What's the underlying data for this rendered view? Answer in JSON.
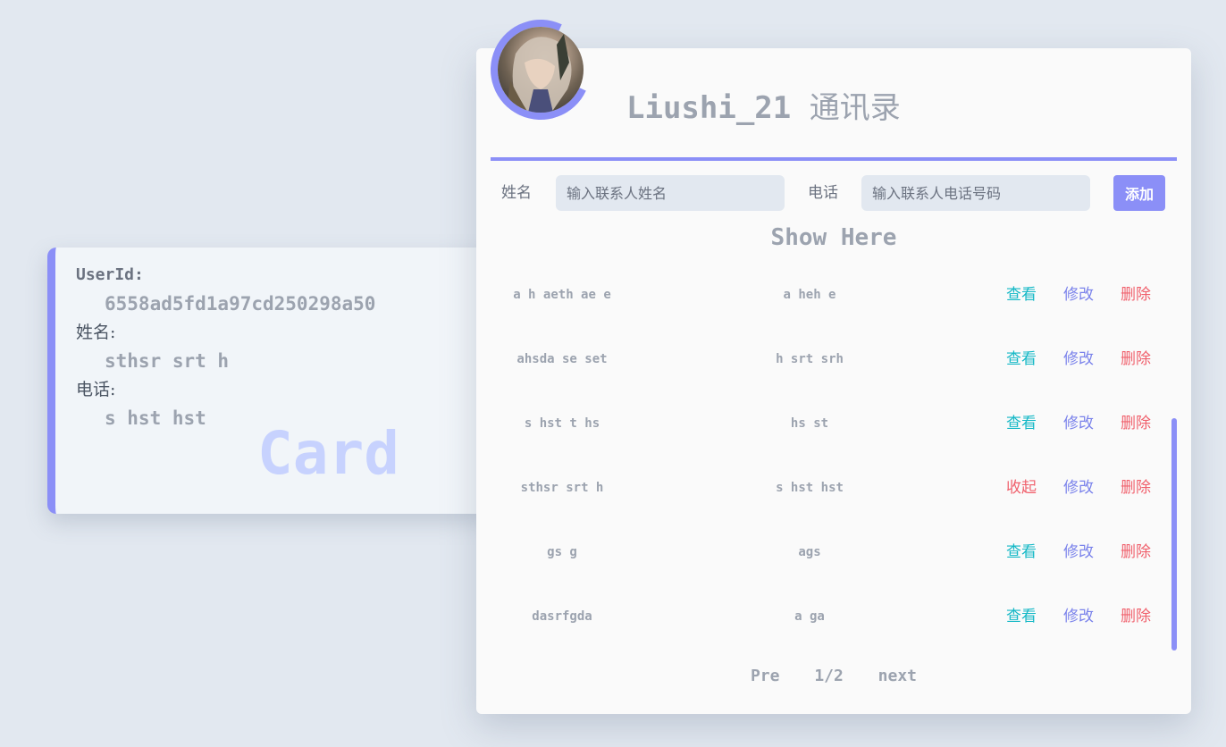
{
  "detail_card": {
    "userid_label": "UserId:",
    "userid_value": "6558ad5fd1a97cd250298a50",
    "name_label": "姓名:",
    "name_value": "sthsr srt h",
    "phone_label": "电话:",
    "phone_value": "s hst hst",
    "watermark": "Card"
  },
  "panel": {
    "title_en": "Liushi_21",
    "title_cn": "通讯录",
    "form": {
      "name_label": "姓名",
      "name_placeholder": "输入联系人姓名",
      "phone_label": "电话",
      "phone_placeholder": "输入联系人电话号码",
      "add_label": "添加"
    },
    "list_heading": "Show Here",
    "contacts": [
      {
        "name": "a h aeth ae e",
        "phone": "a heh e",
        "view": "查看",
        "edit": "修改",
        "delete": "删除",
        "view_color": "#14b8c6"
      },
      {
        "name": "ahsda se set",
        "phone": "h srt srh",
        "view": "查看",
        "edit": "修改",
        "delete": "删除",
        "view_color": "#14b8c6"
      },
      {
        "name": "s hst t hs",
        "phone": "hs st",
        "view": "查看",
        "edit": "修改",
        "delete": "删除",
        "view_color": "#14b8c6"
      },
      {
        "name": "sthsr srt h",
        "phone": "s hst hst",
        "view": "收起",
        "edit": "修改",
        "delete": "删除",
        "view_color": "#f0616d"
      },
      {
        "name": "gs g",
        "phone": "ags",
        "view": "查看",
        "edit": "修改",
        "delete": "删除",
        "view_color": "#14b8c6"
      },
      {
        "name": "dasrfgda",
        "phone": "a ga",
        "view": "查看",
        "edit": "修改",
        "delete": "删除",
        "view_color": "#14b8c6"
      }
    ],
    "pager": {
      "prev": "Pre",
      "page": "1/2",
      "next": "next"
    }
  },
  "colors": {
    "accent": "#8b8ff7",
    "view": "#14b8c6",
    "collapse": "#f0616d",
    "edit": "#7b83eb",
    "delete": "#f0616d",
    "muted_text": "#9ca3af"
  }
}
